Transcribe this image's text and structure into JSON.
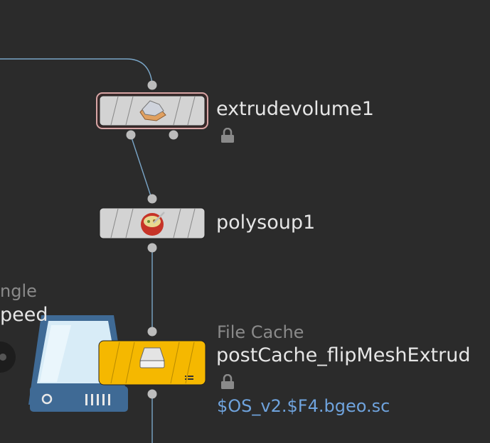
{
  "network": {
    "nodes": [
      {
        "name": "extrudevolume1",
        "icon": "extrude-volume-icon",
        "locked": true,
        "selected": true
      },
      {
        "name": "polysoup1",
        "icon": "polysoup-icon",
        "locked": false
      },
      {
        "type_label": "File Cache",
        "name": "postCache_flipMeshExtrud",
        "icon": "file-cache-disk-icon",
        "locked": true,
        "file_path": "$OS_v2.$F4.bgeo.sc",
        "color": "#f5b800"
      }
    ],
    "offscreen_node": {
      "label_line1": "ngle",
      "label_line2": "peed"
    },
    "colors": {
      "background": "#2b2b2b",
      "wire": "#7aa6c8",
      "node_body": "#d3d3d3",
      "file_cache": "#f5b800",
      "text": "#e6e6e6",
      "path_text": "#6fa3dd"
    }
  }
}
